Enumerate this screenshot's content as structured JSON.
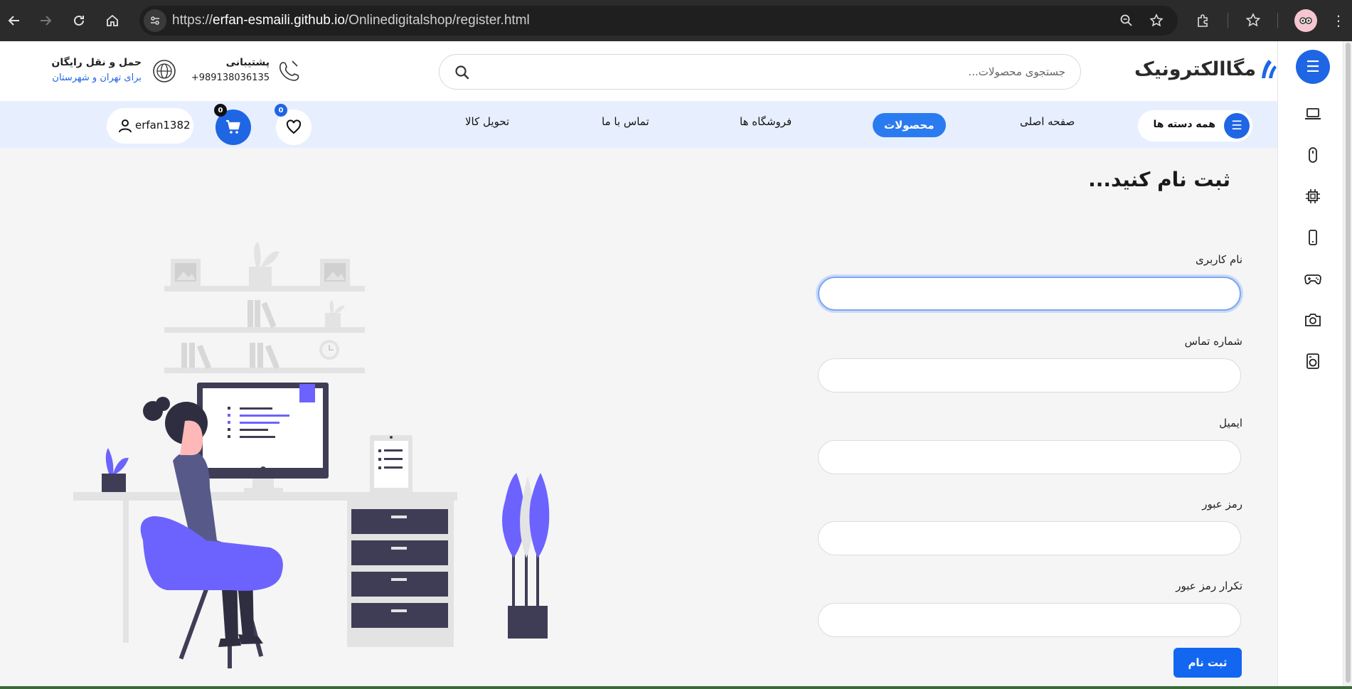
{
  "browser": {
    "url_scheme": "https://",
    "url_host": "erfan-esmaili.github.io",
    "url_path": "/Onlinedigitalshop/register.html",
    "icons": [
      "back-icon",
      "forward-icon",
      "reload-icon",
      "home-icon",
      "site-info-icon",
      "zoom-icon",
      "bookmark-star-icon",
      "extensions-icon",
      "reading-list-icon",
      "profile-avatar",
      "menu-icon"
    ]
  },
  "header": {
    "logo_text": "مگاالکترونیک",
    "search_placeholder": "جستجوی محصولات...",
    "support_title": "پشتیبانی",
    "support_phone": "+989138036135",
    "shipping_title": "حمل و نقل رایگان",
    "shipping_sub": "برای تهران و شهرستان"
  },
  "nav": {
    "all_categories": "همه دسته ها",
    "links": [
      "صفحه اصلی",
      "محصولات",
      "فروشگاه ها",
      "تماس با ما",
      "تحویل کالا"
    ],
    "active_index": 1,
    "wishlist_count": "0",
    "cart_count": "0",
    "username": "erfan1382"
  },
  "side_categories": [
    "laptop-icon",
    "mouse-icon",
    "cpu-icon",
    "phone-icon",
    "gamepad-icon",
    "camera-icon",
    "washing-machine-icon"
  ],
  "form": {
    "title": "ثبت نام کنید...",
    "fields": [
      {
        "label": "نام کاربری",
        "value": ""
      },
      {
        "label": "شماره تماس",
        "value": ""
      },
      {
        "label": "ایمیل",
        "value": ""
      },
      {
        "label": "رمز عبور",
        "value": ""
      },
      {
        "label": "تکرار رمز عبور",
        "value": ""
      }
    ],
    "submit_label": "ثبت نام"
  },
  "colors": {
    "accent": "#1f66e5",
    "nav_bg": "#e7efff",
    "illustration_purple": "#6c63ff"
  }
}
